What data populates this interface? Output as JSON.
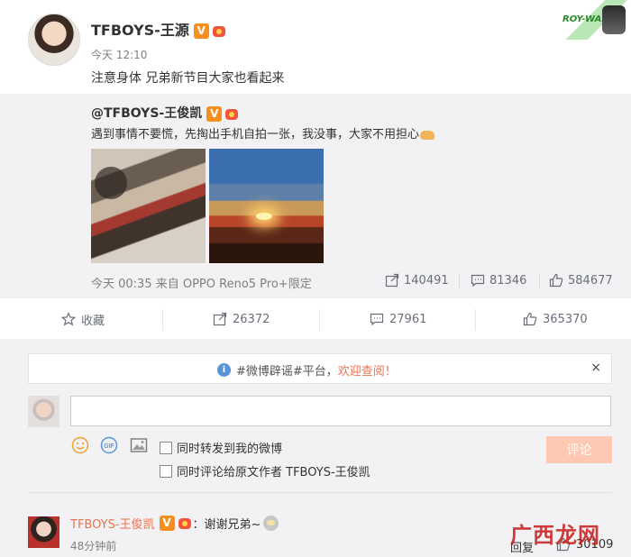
{
  "post": {
    "author": "TFBOYS-王源",
    "verified_badge": "V",
    "time": "今天 12:10",
    "text": "注意身体 兄弟新节目大家也看起来"
  },
  "repost": {
    "author": "@TFBOYS-王俊凯",
    "verified_badge": "V",
    "text": "遇到事情不要慌，先掏出手机自拍一张，我没事，大家不用担心",
    "meta": "今天 00:35 来自 OPPO Reno5 Pro+限定",
    "shares": "140491",
    "comments": "81346",
    "likes": "584677"
  },
  "actions": {
    "favorite": "收藏",
    "shares": "26372",
    "comments": "27961",
    "likes": "365370"
  },
  "notice": {
    "prefix": "#微博辟谣#平台，",
    "link": "欢迎查阅！",
    "close": "×"
  },
  "composer": {
    "input_value": "",
    "repost_option": "同时转发到我的微博",
    "comment_option": "同时评论给原文作者 TFBOYS-王俊凯",
    "gif_label": "GIF",
    "submit": "评论"
  },
  "comment": {
    "author": "TFBOYS-王俊凯",
    "verified_badge": "V",
    "text": "：谢谢兄弟~",
    "time": "48分钟前",
    "reply": "回复",
    "likes": "30109"
  },
  "watermark": "广西龙网",
  "corner_logo_text": "ROY-WANG",
  "colors": {
    "accent": "#eb7350",
    "verified": "#f78f1e",
    "submit_disabled": "#fdc9b3",
    "info": "#5a94d8"
  }
}
